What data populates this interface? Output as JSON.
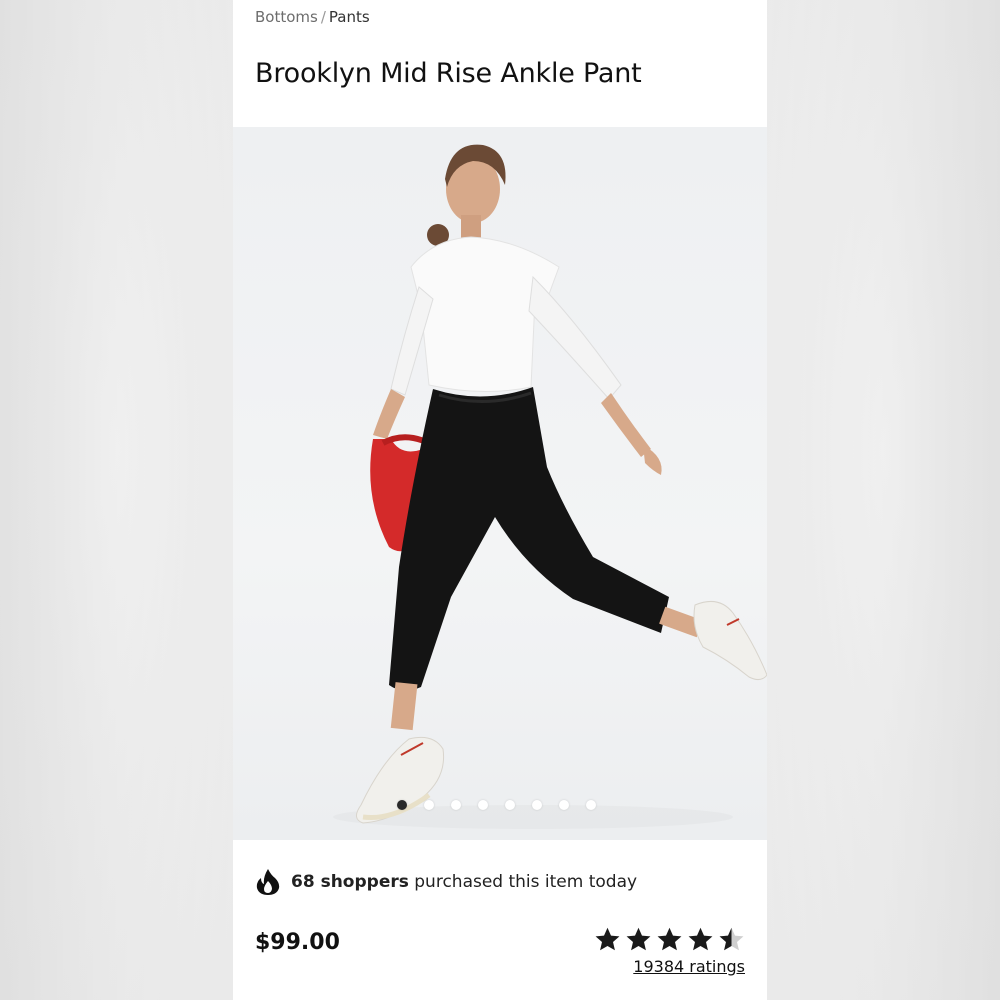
{
  "breadcrumb": {
    "parent": "Bottoms",
    "separator": "/",
    "current": "Pants"
  },
  "product": {
    "title": "Brooklyn Mid Rise Ankle Pant",
    "price": "$99.00",
    "rating_value": 4.5,
    "ratings_label": "19384 ratings"
  },
  "gallery": {
    "image_count": 8,
    "active_index": 0,
    "background": "#eef0f2"
  },
  "social_proof": {
    "icon": "flame-icon",
    "count_text": "68 shoppers",
    "rest_text": "purchased this item today"
  },
  "colors": {
    "text": "#111111",
    "muted": "#6d6d6d",
    "dot_active": "#2a2a2a",
    "dot_inactive": "#ffffff",
    "star": "#1a1a1a"
  }
}
